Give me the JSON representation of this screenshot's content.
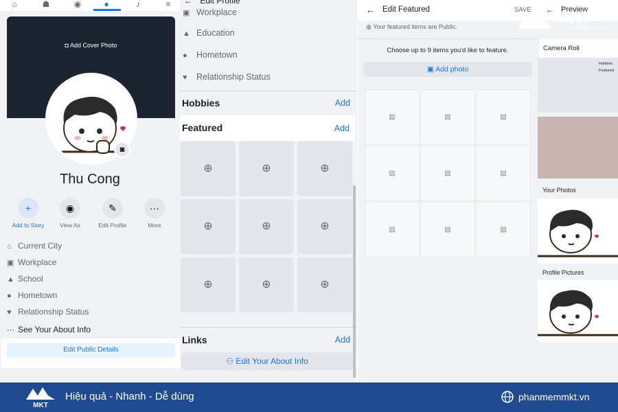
{
  "profile_panel": {
    "cover_label": "Add Cover Photo",
    "name": "Thu Cong",
    "actions": [
      {
        "label": "Add to Story",
        "icon": "plus-icon"
      },
      {
        "label": "View As",
        "icon": "eye-icon"
      },
      {
        "label": "Edit Profile",
        "icon": "edit-profile-icon"
      },
      {
        "label": "More",
        "icon": "more-icon"
      }
    ],
    "about": [
      {
        "label": "Current City",
        "icon": "home-icon"
      },
      {
        "label": "Workplace",
        "icon": "briefcase-icon"
      },
      {
        "label": "School",
        "icon": "school-icon"
      },
      {
        "label": "Hometown",
        "icon": "location-pin-icon"
      },
      {
        "label": "Relationship Status",
        "icon": "heart-icon"
      },
      {
        "label": "See Your About Info",
        "icon": "more-icon"
      }
    ],
    "edit_public_details": "Edit Public Details"
  },
  "edit_profile_panel": {
    "header_title": "Edit Profile",
    "workplace_label": "Workplace",
    "rows": [
      {
        "label": "Education",
        "icon": "school-icon"
      },
      {
        "label": "Hometown",
        "icon": "location-pin-icon"
      },
      {
        "label": "Relationship Status",
        "icon": "heart-icon"
      }
    ],
    "hobbies_title": "Hobbies",
    "hobbies_add": "Add",
    "featured_title": "Featured",
    "featured_add": "Add",
    "links_title": "Links",
    "links_add": "Add",
    "edit_about_info": "Edit Your About Info"
  },
  "edit_featured_panel": {
    "title": "Edit Featured",
    "save": "SAVE",
    "preview": "Preview",
    "public_note": "Your featured items are Public.",
    "choose_note": "Choose up to 9 items you'd like to feature.",
    "add_photo": "Add photo"
  },
  "photos_panel": {
    "camera_roll": "Camera Roll",
    "hobbies_mini": "Hobbies",
    "featured_mini": "Featured",
    "your_photos": "Your Photos",
    "profile_pictures": "Profile Pictures"
  },
  "brand": {
    "logo_text": "MKT",
    "logo_sub": "Phần mềm Marketing đa kênh",
    "slogan": "Hiệu quả - Nhanh - Dễ dùng",
    "website": "phanmemmkt.vn"
  },
  "colors": {
    "accent": "#1b74e4",
    "footer": "#1f4a8f",
    "panel_bg": "#f0f2f5"
  }
}
